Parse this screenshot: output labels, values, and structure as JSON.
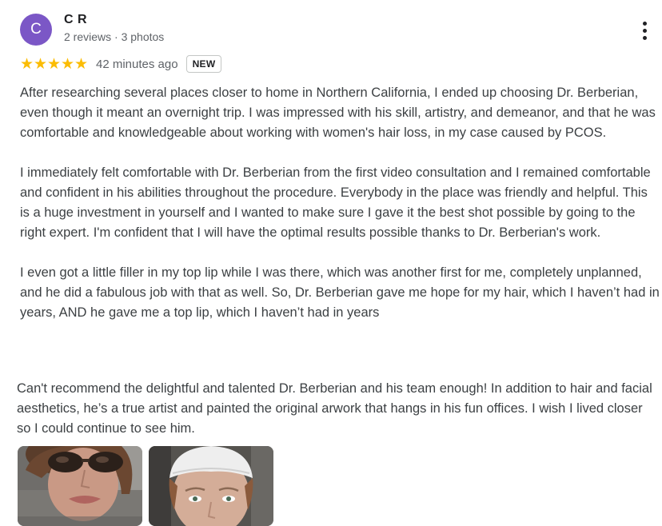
{
  "review": {
    "author_initial": "C",
    "author_name": "C R",
    "author_meta": "2 reviews · 3 photos",
    "rating": 5,
    "time_ago": "42 minutes ago",
    "badge": "NEW",
    "paragraphs": [
      "After researching several places closer to home in Northern California, I ended up choosing Dr. Berberian, even though it meant an overnight trip. I was impressed with his skill, artistry, and demeanor, and that he was comfortable and knowledgeable about working with women's hair loss, in my case caused by PCOS.",
      "I immediately felt comfortable with Dr. Berberian from the first video consultation and I remained comfortable and confident in his abilities throughout the procedure. Everybody in the place was friendly and helpful. This is a huge investment in yourself and I wanted to make sure I gave it the best shot possible by going to the right expert. I'm confident that I will have the optimal results possible thanks to Dr. Berberian's work.",
      "I even got a little filler in my top lip while I was there, which was another first for me, completely unplanned, and he did a fabulous job with that as well. So, Dr. Berberian gave me hope for my hair, which I haven’t had in years, AND he gave me a top lip, which I haven’t had in years"
    ],
    "closing": "Can't recommend the delightful and talented Dr. Berberian and his team enough! In addition to hair and facial aesthetics, he’s a true artist and painted the original arwork that hangs in his fun offices. I wish I lived closer so I could continue to see him.",
    "avatar_color": "#7b57c6",
    "star_color": "#fbbc04",
    "menu_icon": "more-vert-icon"
  }
}
